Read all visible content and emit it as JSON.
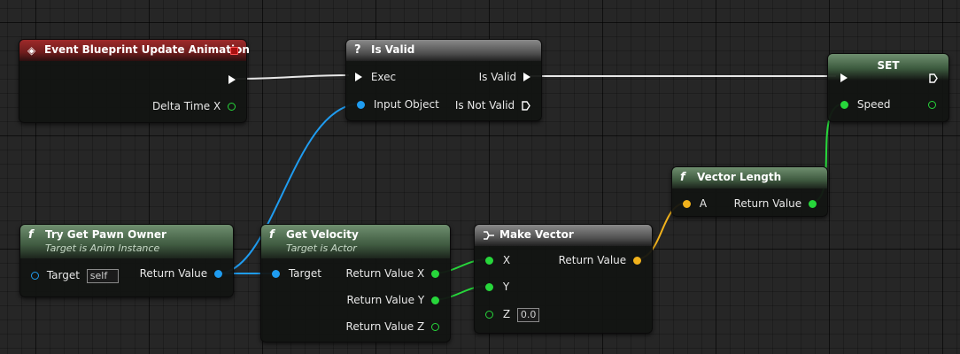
{
  "nodes": {
    "event": {
      "title": "Event Blueprint Update Animation",
      "pins": {
        "delta": "Delta Time X"
      }
    },
    "is_valid": {
      "title": "Is Valid",
      "icon": "?",
      "pins": {
        "exec": "Exec",
        "is_valid": "Is Valid",
        "input": "Input Object",
        "is_not_valid": "Is Not Valid"
      }
    },
    "set": {
      "title": "SET",
      "pins": {
        "speed": "Speed"
      }
    },
    "vector_length": {
      "title": "Vector Length",
      "icon": "f",
      "pins": {
        "a": "A",
        "ret": "Return Value"
      }
    },
    "pawn_owner": {
      "title": "Try Get Pawn Owner",
      "subtitle": "Target is Anim Instance",
      "icon": "f",
      "pins": {
        "target": "Target",
        "target_default": "self",
        "ret": "Return Value"
      }
    },
    "velocity": {
      "title": "Get Velocity",
      "subtitle": "Target is Actor",
      "icon": "f",
      "pins": {
        "target": "Target",
        "rx": "Return Value X",
        "ry": "Return Value Y",
        "rz": "Return Value Z"
      }
    },
    "make_vector": {
      "title": "Make Vector",
      "pins": {
        "x": "X",
        "y": "Y",
        "z": "Z",
        "z_default": "0.0",
        "ret": "Return Value"
      }
    }
  },
  "colors": {
    "exec": "#ffffff",
    "object": "#1f9cf0",
    "float": "#27d63b",
    "vector": "#f1b21c",
    "event_header": "#9e2a2a",
    "pure_header": "#4f6e50",
    "macro_header": "#6a6a6a"
  }
}
